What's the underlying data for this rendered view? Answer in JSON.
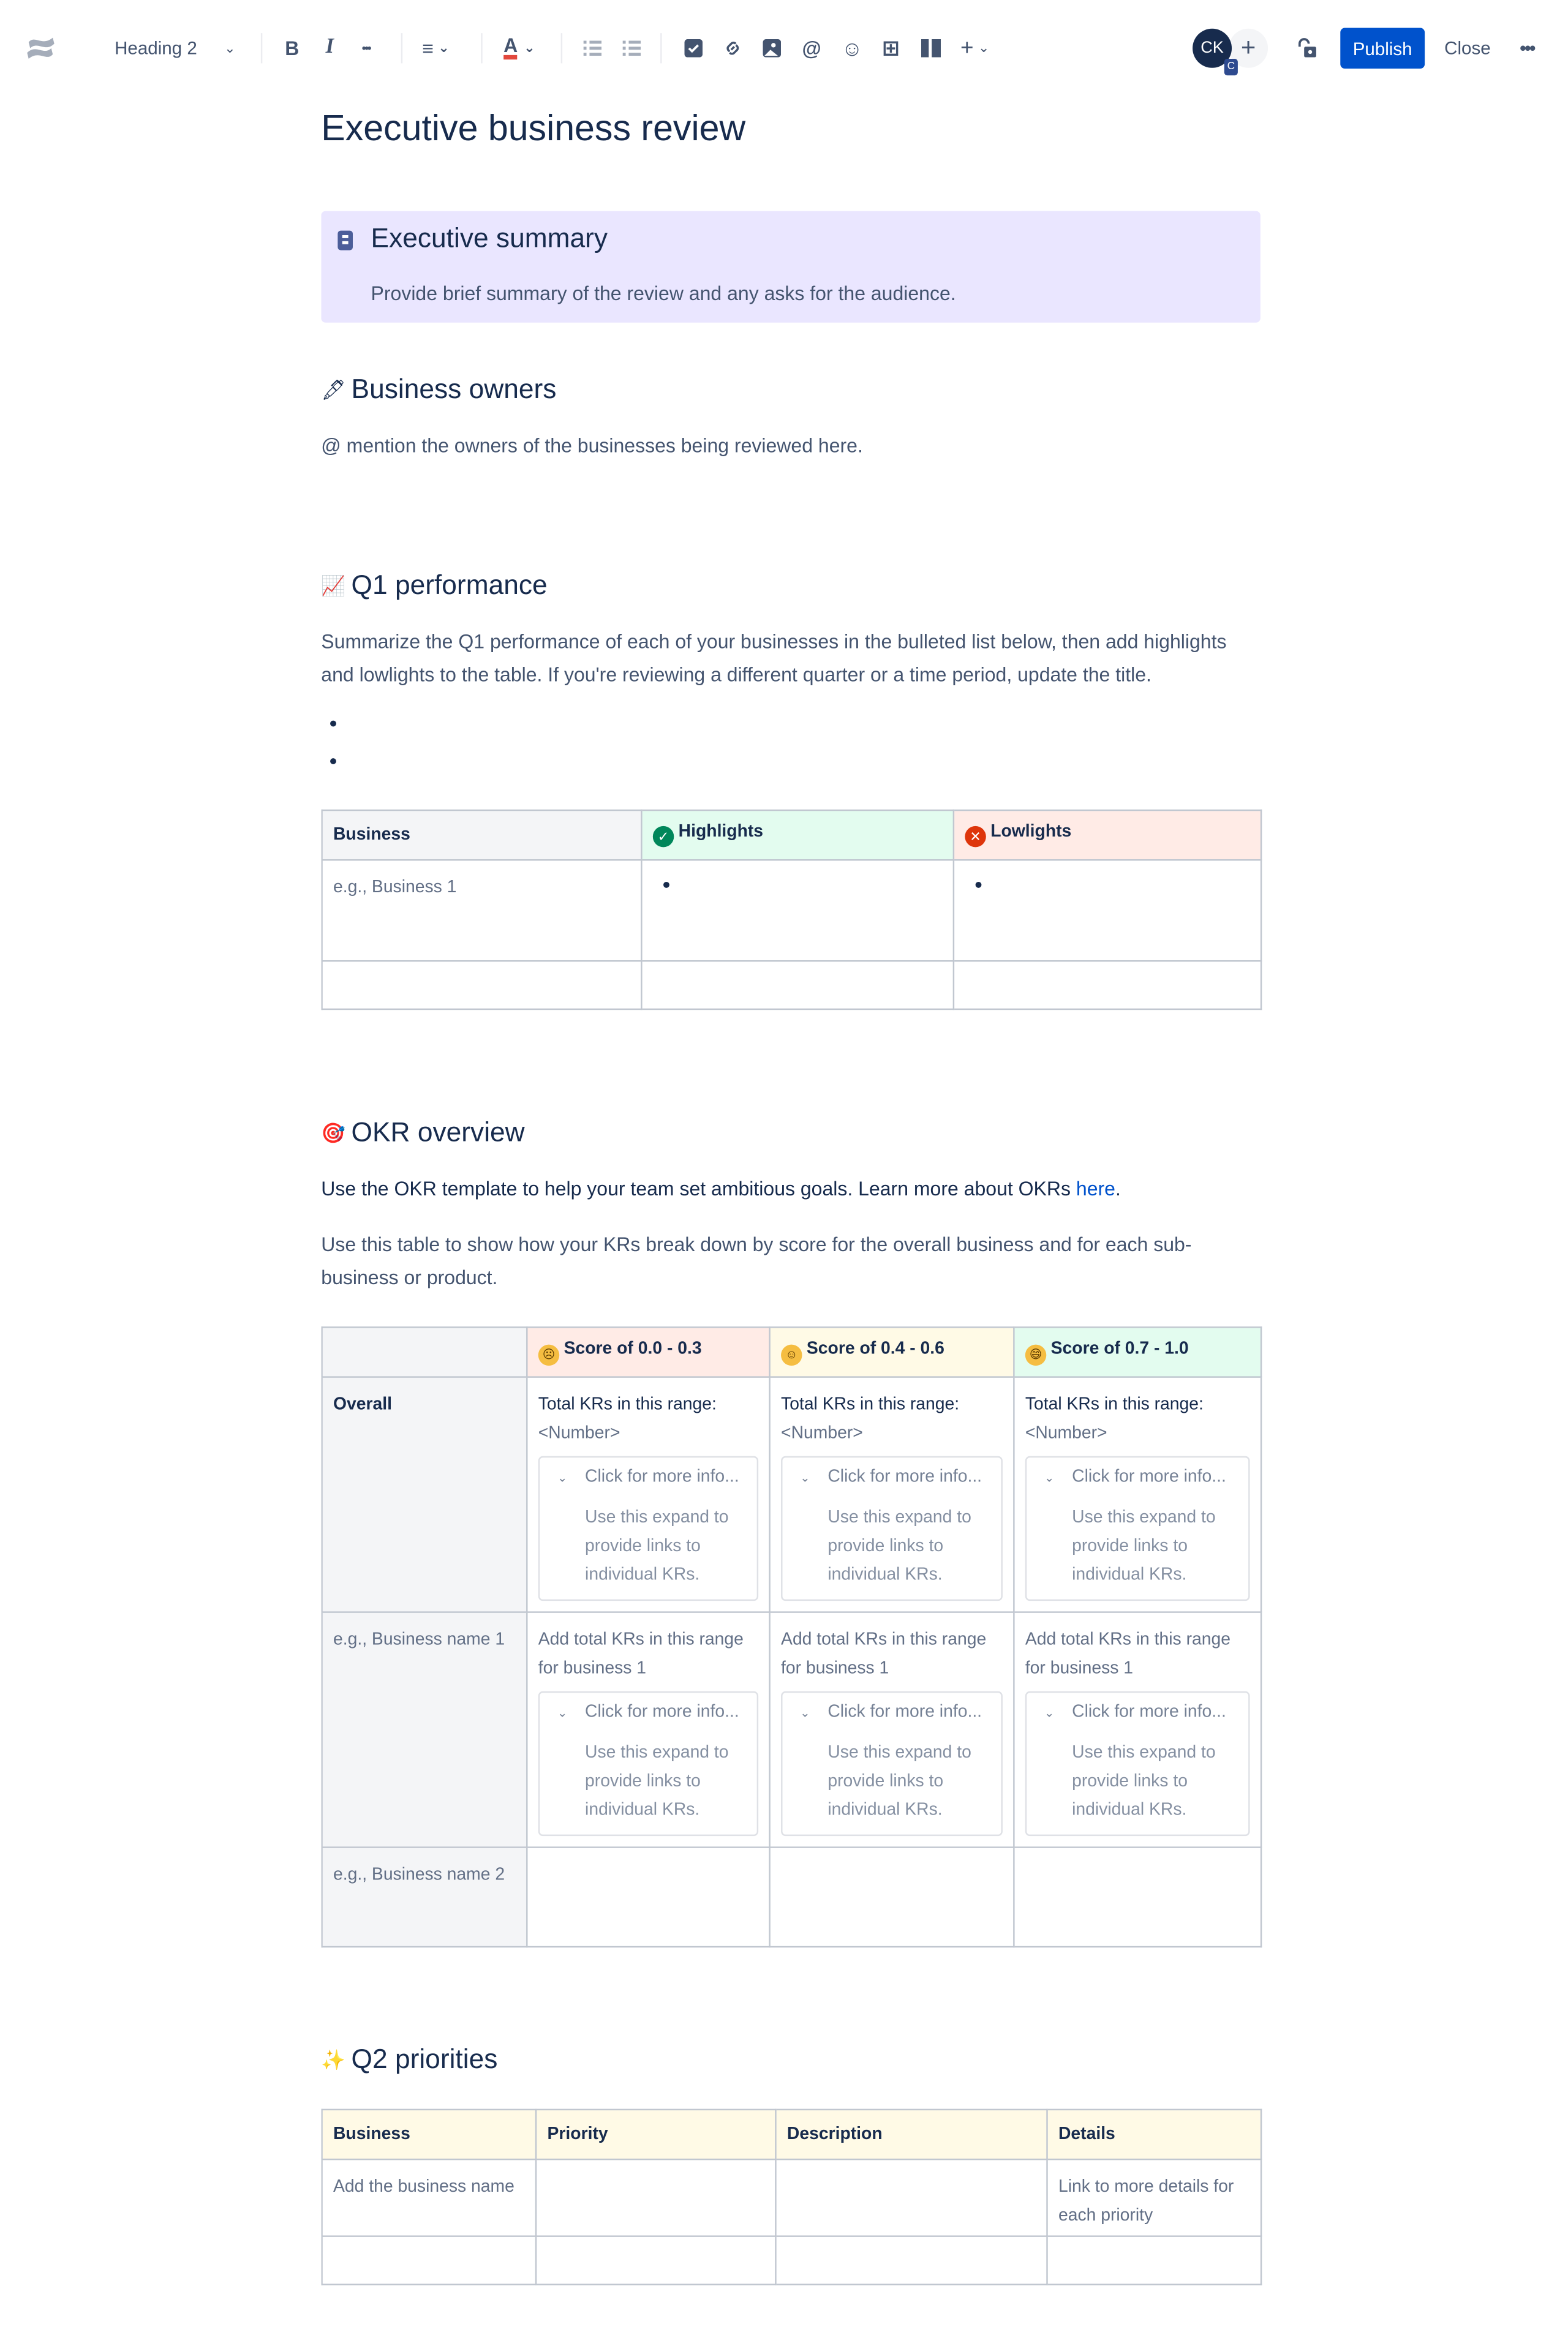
{
  "toolbar": {
    "logo_icon": "confluence-logo-icon",
    "text_style": "Heading 2",
    "bold_icon": "B",
    "italic_icon": "I",
    "more_formatting_icon": "•••",
    "align_icon": "≡",
    "text_color_icon": "A",
    "bullet_list_icon": "bullet-list-icon",
    "numbered_list_icon": "numbered-list-icon",
    "task_icon": "☑",
    "link_icon": "🔗",
    "image_icon": "image-icon",
    "mention_icon": "@",
    "emoji_icon": "☺",
    "table_icon": "⊞",
    "layout_icon": "▥",
    "insert_icon": "+",
    "avatar_initials": "CK",
    "avatar_badge": "C",
    "add_collaborator": "+",
    "publish_label": "Publish",
    "close_label": "Close",
    "more_label": "•••"
  },
  "page": {
    "title": "Executive business review"
  },
  "executive_summary": {
    "title": "Executive summary",
    "text": "Provide brief summary of the review and any asks for the audience."
  },
  "business_owners": {
    "emoji": "🖋",
    "title": "Business owners",
    "text": "@ mention the owners of the businesses being reviewed here."
  },
  "q1_performance": {
    "emoji": "📈",
    "title": "Q1 performance",
    "text": "Summarize the Q1 performance of each of your businesses in the bulleted list below, then add highlights and lowlights to the table. If you're reviewing a different quarter or a time period, update the title.",
    "table": {
      "headers": [
        "Business",
        "Highlights",
        "Lowlights"
      ],
      "highlight_icon": "✓",
      "lowlight_icon": "✕",
      "rows": [
        [
          "e.g., Business 1",
          "",
          ""
        ],
        [
          "",
          "",
          ""
        ]
      ]
    }
  },
  "okr_overview": {
    "emoji": "🎯",
    "title": "OKR overview",
    "intro": "Use the OKR template to help your team set ambitious goals. Learn more about OKRs ",
    "intro_link": "here",
    "intro_end": ".",
    "text": "Use this table to show how your KRs break down by score for the overall business and for each sub-business or product.",
    "table": {
      "headers": [
        "",
        "Score of 0.0 - 0.3",
        "Score of 0.4 - 0.6",
        "Score of 0.7 - 1.0"
      ],
      "header_faces": [
        "☹",
        "☺",
        "😄"
      ],
      "overall_label": "Overall",
      "overall_total_label": "Total KRs in this range:",
      "overall_number": "<Number>",
      "expand_title": "Click for more info...",
      "expand_body": "Use this expand to provide links to individual KRs.",
      "business1_label": "e.g., Business name 1",
      "business1_text": "Add total KRs in this range for business 1",
      "business2_label": "e.g., Business name 2"
    }
  },
  "q2_priorities": {
    "emoji": "✨",
    "title": "Q2 priorities",
    "table": {
      "headers": [
        "Business",
        "Priority",
        "Description",
        "Details"
      ],
      "rows": [
        [
          "Add the business name",
          "",
          "",
          "Link to more details for each priority"
        ],
        [
          "",
          "",
          "",
          ""
        ]
      ]
    }
  },
  "colors": {
    "accent": "#0052CC",
    "text": "#172B4D",
    "subtle_text": "#44546F",
    "panel_bg": "#EAE6FF",
    "green_header": "#E3FCEF",
    "red_header": "#FFEBE6",
    "yellow_header": "#FFFAE6",
    "grey_header": "#F4F5F7"
  }
}
